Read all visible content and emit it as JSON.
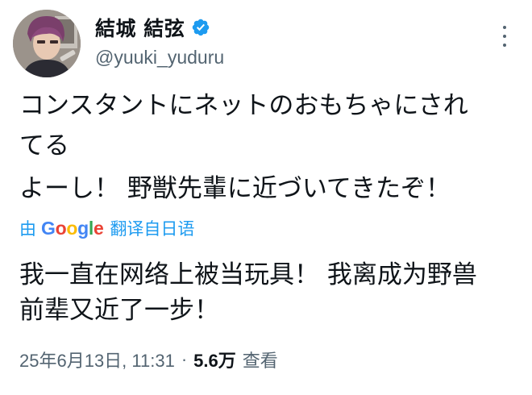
{
  "author": {
    "display_name": "結城 結弦",
    "handle": "@yuuki_yuduru",
    "verified": true,
    "verified_color": "#1d9bf0"
  },
  "tweet": {
    "lines": [
      "コンスタントにネットのおもちゃにされ",
      "てる",
      "よーし！ 野獣先輩に近づいてきたぞ！"
    ]
  },
  "translation": {
    "prefix": "由",
    "logo": "Google",
    "suffix": "翻译自日语",
    "lines": [
      "我一直在网络上被当玩具！ 我离成为野兽",
      "前辈又近了一步！"
    ]
  },
  "meta": {
    "timestamp": "25年6月13日, 11:31",
    "separator": "·",
    "views_count": "5.6万",
    "views_label": "查看"
  },
  "icons": {
    "verified": "verified-badge-icon",
    "more": "more-options-icon"
  }
}
